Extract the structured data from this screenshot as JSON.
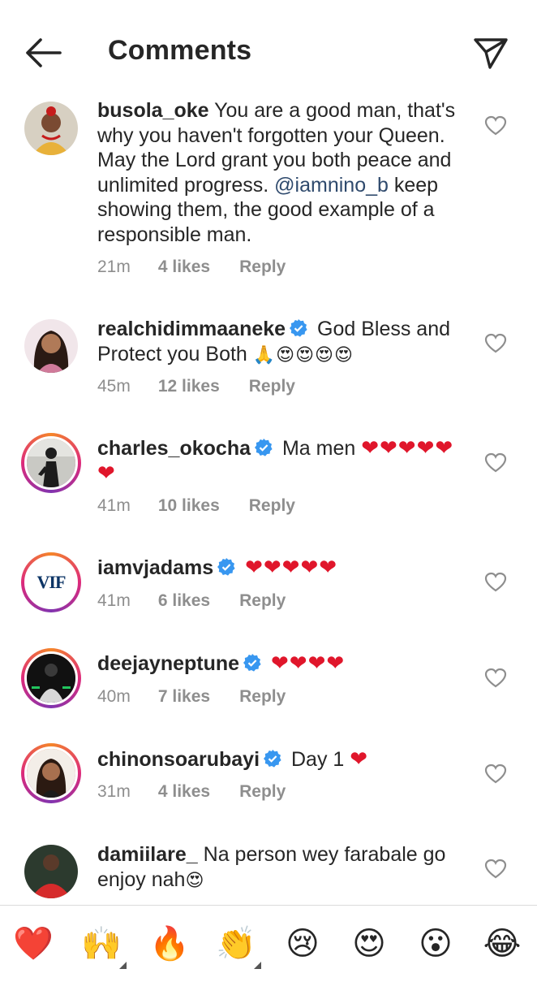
{
  "header": {
    "title": "Comments"
  },
  "comments": [
    {
      "username": "busola_oke",
      "verified": false,
      "text_before": "You are a good man, that's why you haven't forgotten your Queen. May the Lord grant you both peace and unlimited progress.",
      "mention": "@iamnino_b",
      "text_after": "keep showing them, the good example of a responsible man.",
      "time": "21m",
      "likes": "4 likes",
      "reply": "Reply"
    },
    {
      "username": "realchidimmaaneke",
      "verified": true,
      "text": "God Bless and Protect you Both",
      "emojis": "🙏😍😍😍😍",
      "time": "45m",
      "likes": "12 likes",
      "reply": "Reply"
    },
    {
      "username": "charles_okocha",
      "verified": true,
      "text": "Ma men",
      "emojis": "❤❤❤❤❤❤",
      "time": "41m",
      "likes": "10 likes",
      "reply": "Reply"
    },
    {
      "username": "iamvjadams",
      "verified": true,
      "text": "",
      "emojis": "❤❤❤❤❤",
      "avatar_text": "VIF",
      "time": "41m",
      "likes": "6 likes",
      "reply": "Reply"
    },
    {
      "username": "deejayneptune",
      "verified": true,
      "text": "",
      "emojis": "❤❤❤❤",
      "time": "40m",
      "likes": "7 likes",
      "reply": "Reply"
    },
    {
      "username": "chinonsoarubayi",
      "verified": true,
      "text": "Day 1",
      "emojis": "❤",
      "time": "31m",
      "likes": "4 likes",
      "reply": "Reply"
    },
    {
      "username": "damiilare_",
      "verified": false,
      "text": "Na person wey farabale go enjoy nah",
      "emojis": "😍"
    }
  ],
  "emoji_bar": [
    "❤️",
    "🙌",
    "🔥",
    "👏",
    "😢",
    "😍",
    "😮",
    "😂"
  ],
  "colors": {
    "accent_blue": "#3897f0",
    "heart_red": "#e0162b",
    "muted_text": "#8e8e8e",
    "mention": "#2f4a6d"
  }
}
